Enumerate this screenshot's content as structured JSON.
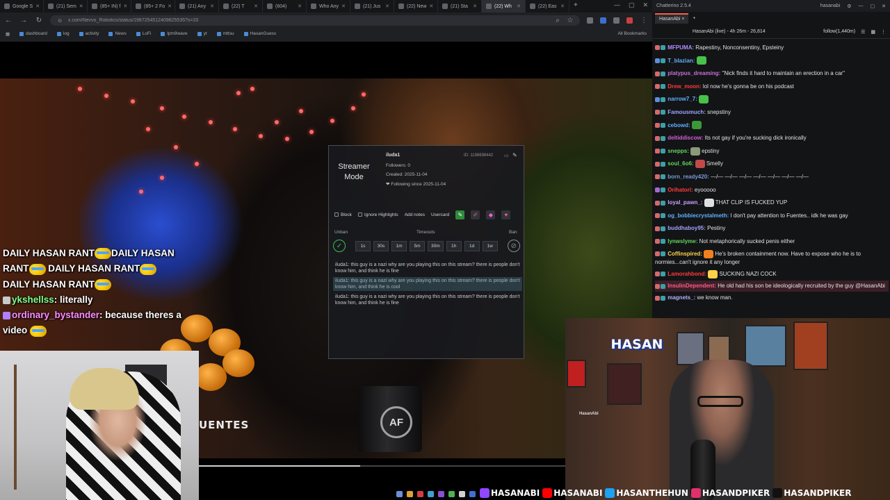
{
  "browser": {
    "tabs": [
      "Google S",
      "(21) Sem",
      "(85+ IN) f",
      "(85+ 2 Fo",
      "(21) Any",
      "(22) T",
      "(604)",
      "Who Any",
      "(21) Jus",
      "(22) New",
      "(21) Sta",
      "(22) Wh",
      "(22) Eas"
    ],
    "active_tab_index": 11,
    "url": "x.com/Nevvo_Robotics/status/1987254512409825535?s=20",
    "bookmarks": [
      "dashboard",
      "log",
      "activity",
      "News",
      "LoFi",
      "lpm9wave",
      "yt",
      "mttsu",
      "HasanGuess"
    ],
    "all_bookmarks": "All Bookmarks"
  },
  "video": {
    "lower_third": "UENTES",
    "mug_logo": "AF",
    "progress": 0.44
  },
  "overlay_chat": {
    "rant_1": "DAILY HASAN RANT",
    "rant_2": "DAILY HASAN",
    "rant_3": "RANT",
    "rant_4": "DAILY HASAN RANT",
    "rant_5": "DAILY HASAN RANT",
    "msg1_user": "ykshellss",
    "msg1_text": "literally",
    "msg2_user": "ordinary_bystander",
    "msg2_text": "because theres a video"
  },
  "popup": {
    "mode_label": "Streamer Mode",
    "username": "iluda1",
    "followers": "Followers: 0",
    "created": "Created: 2025-11-04",
    "following": "❤ Following since 2025-11-04",
    "user_id": "ID: 1198698442",
    "block": "Block",
    "ignore": "Ignore Highlights",
    "add_notes": "Add notes",
    "usercard": "Usercard",
    "unban": "Unban",
    "timeouts": "Timeouts",
    "ban": "Ban",
    "timeout_buttons": [
      "1s",
      "30s",
      "1m",
      "5m",
      "30m",
      "1h",
      "1d",
      "1w"
    ],
    "messages": [
      "iluda1: this guy is a nazi why are you playing this on this stream? there is people don't know him, and think he is fine",
      "iluda1: this guy is a nazi why are you playing this on this stream? there is people don't know him, and think he is cool",
      "iluda1: this guy is a nazi why are you playing this on this stream? there is people don't know him, and think he is fine"
    ]
  },
  "chatterino": {
    "title": "Chatterino 2.5.4",
    "account": "hasanabi",
    "tab": "HasanAbi",
    "header_channel": "HasanAbi (live) - 4h 26m - 26,814",
    "header_followers": "follow(1,440m)",
    "messages": [
      {
        "user": "MFPUMA:",
        "text": "Rapestiny, Nonconsentiny, Epsteiny",
        "color": "#b48cff"
      },
      {
        "user": "T_blazian:",
        "text": "",
        "color": "#5fb0ff"
      },
      {
        "user": "platypus_dreaming:",
        "text": "\"Nick finds it hard to maintain an erection in a car\"",
        "color": "#c86fd8"
      },
      {
        "user": "Drew_moon:",
        "text": "lol now he's gonna be on his podcast",
        "color": "#ff3b3b"
      },
      {
        "user": "narrow7_7:",
        "text": "",
        "color": "#5fb0ff"
      },
      {
        "user": "Famousmuch:",
        "text": "snepstiny",
        "color": "#9ea2ff"
      },
      {
        "user": "cebowd:",
        "text": "",
        "color": "#5fb0ff"
      },
      {
        "user": "deltiddiscow:",
        "text": "Its not gay if you're sucking dick ironically",
        "color": "#d05fd8"
      },
      {
        "user": "snepps:",
        "text": "epstiny",
        "color": "#63d65f"
      },
      {
        "user": "soul_6o6:",
        "text": "Smelly",
        "color": "#63d65f"
      },
      {
        "user": "born_ready420:",
        "text": "—/— —/— —/— —/— —/— —/— —/—",
        "color": "#7a9ad8"
      },
      {
        "user": "Orihatori:",
        "text": "eyooooo",
        "color": "#ff3b3b"
      },
      {
        "user": "loyal_pawn_:",
        "text": "THAT CLIP IS FUCKED YUP",
        "color": "#c8a0ff"
      },
      {
        "user": "og_bobbiecrystalmeth:",
        "text": "I don't pay attention to Fuentes.. idk he was gay",
        "color": "#5fb0ff"
      },
      {
        "user": "buddhaboy95:",
        "text": "Pestiny",
        "color": "#a0a0ff"
      },
      {
        "user": "lynwslyme:",
        "text": "Not metaphorically sucked penis either",
        "color": "#63d65f"
      },
      {
        "user": "Coffinspired:",
        "text": "He's broken containment now. Have to expose who he is to normies...can't ignore it any longer",
        "color": "#ffd24a"
      },
      {
        "user": "Lamorahbond:",
        "text": "SUCKING NAZI COCK",
        "color": "#ff3b3b"
      },
      {
        "user": "InsulinDependent:",
        "text": "He old had his son be ideologically recruited by the guy @HasanAbi",
        "color": "#ff5a8a"
      },
      {
        "user": "magnets_:",
        "text": "we know man.",
        "color": "#b0b0ff"
      }
    ]
  },
  "webcam2": {
    "logo": "HASAN",
    "label": "HasanAbi"
  },
  "social_bar": {
    "items": [
      "HASANABI",
      "HASANABI",
      "HASANTHEHUN",
      "HASANDPIKER",
      "HASANDPIKER"
    ],
    "icon_colors": [
      "#9146ff",
      "#ff0000",
      "#1da1f2",
      "#e1306c",
      "#111111"
    ]
  }
}
